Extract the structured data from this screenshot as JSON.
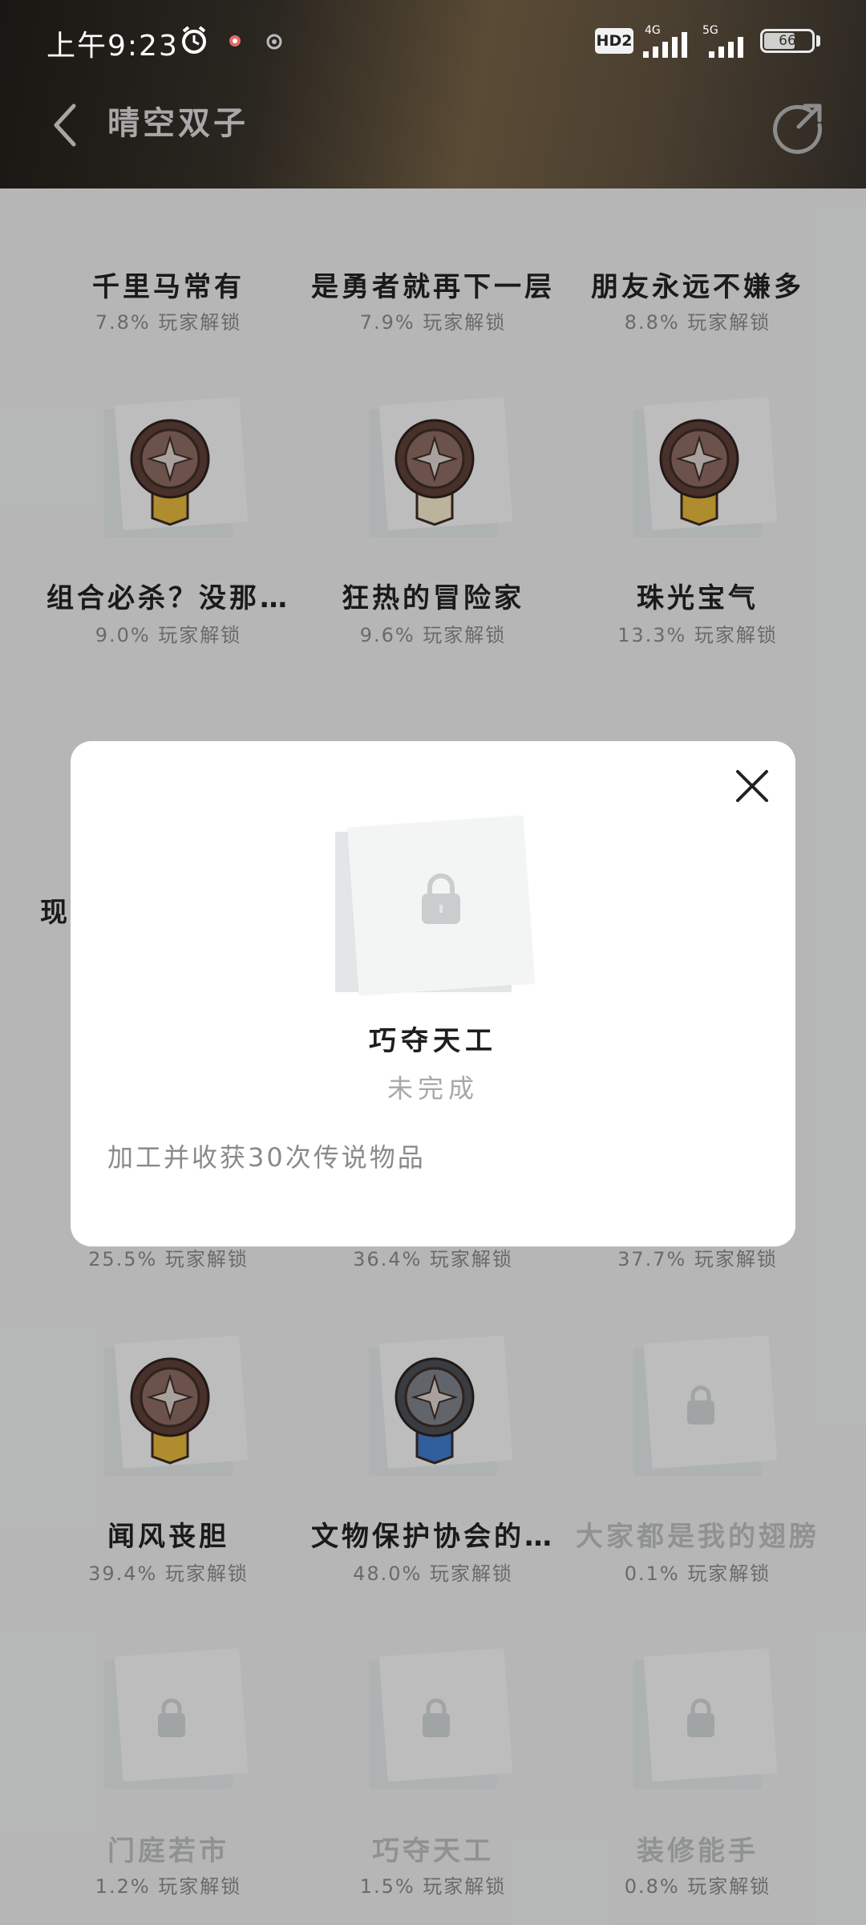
{
  "status_bar": {
    "time": "上午9:23",
    "hd_label": "HD2",
    "net1": "4G",
    "net2": "5G",
    "battery": "66",
    "battery_level": 66
  },
  "nav": {
    "title": "晴空双子",
    "back_icon": "chevron-left-icon",
    "share_icon": "share-icon"
  },
  "achievements": [
    {
      "name": "千里马常有",
      "pct": "7.8% 玩家解锁",
      "medal": "bronze-blue"
    },
    {
      "name": "是勇者就再下一层",
      "pct": "7.9% 玩家解锁",
      "medal": "bronze-blue"
    },
    {
      "name": "朋友永远不嫌多",
      "pct": "8.8% 玩家解锁",
      "medal": "bronze-gold"
    },
    {
      "name": "组合必杀？没那…",
      "pct": "9.0% 玩家解锁",
      "medal": "bronze-gold"
    },
    {
      "name": "狂热的冒险家",
      "pct": "9.6% 玩家解锁",
      "medal": "bronze-white"
    },
    {
      "name": "珠光宝气",
      "pct": "13.3% 玩家解锁",
      "medal": "bronze-gold"
    },
    {
      "name": "现",
      "pct": "25.5% 玩家解锁"
    },
    {
      "name": "",
      "pct": "36.4% 玩家解锁"
    },
    {
      "name": "",
      "pct": "37.7% 玩家解锁"
    },
    {
      "name": "闻风丧胆",
      "pct": "39.4% 玩家解锁",
      "medal": "bronze-gold"
    },
    {
      "name": "文物保护协会的…",
      "pct": "48.0% 玩家解锁",
      "medal": "silver-blue"
    },
    {
      "name": "大家都是我的翅膀",
      "pct": "0.1% 玩家解锁",
      "locked": true
    },
    {
      "name": "门庭若市",
      "pct": "1.2% 玩家解锁",
      "locked": true
    },
    {
      "name": "巧夺天工",
      "pct": "1.5% 玩家解锁",
      "locked": true
    },
    {
      "name": "装修能手",
      "pct": "0.8% 玩家解锁",
      "locked": true
    }
  ],
  "modal": {
    "title": "巧夺天工",
    "status": "未完成",
    "description": "加工并收获30次传说物品",
    "close_icon": "close-icon",
    "badge_icon": "lock-icon"
  },
  "colors": {
    "header_dark": "#191713",
    "header_gold": "#5a4b35",
    "page_bg": "#e9eaea",
    "medal_bronze": "#7a5a4f",
    "medal_ribbon_blue": "#3f79c8",
    "medal_ribbon_gold": "#e0b43a"
  }
}
